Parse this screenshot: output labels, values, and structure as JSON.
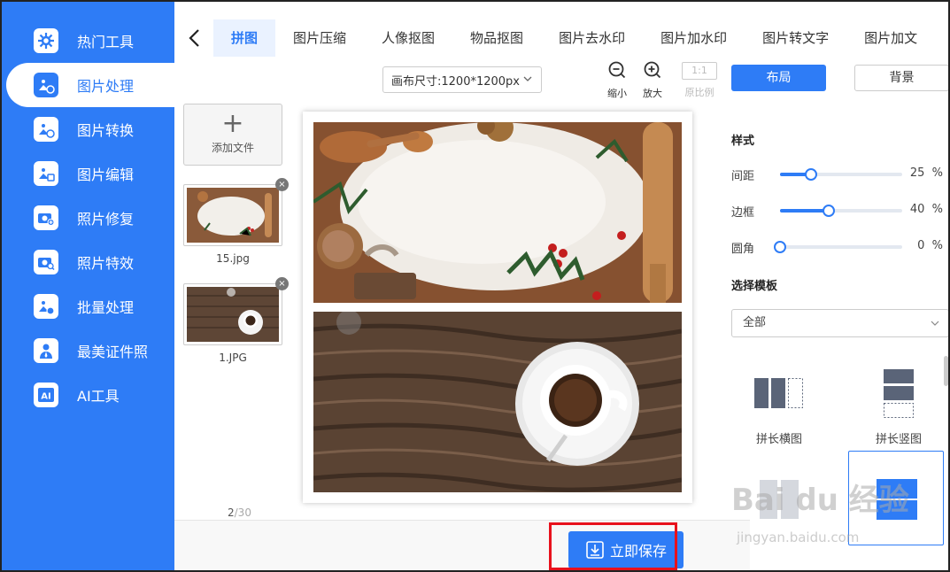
{
  "sidebar": {
    "items": [
      {
        "label": "热门工具",
        "icon": "gear-icon"
      },
      {
        "label": "图片处理",
        "icon": "image-clock-icon",
        "active": true
      },
      {
        "label": "图片转换",
        "icon": "image-convert-icon"
      },
      {
        "label": "图片编辑",
        "icon": "image-edit-icon"
      },
      {
        "label": "照片修复",
        "icon": "camera-plus-icon"
      },
      {
        "label": "照片特效",
        "icon": "camera-search-icon"
      },
      {
        "label": "批量处理",
        "icon": "image-batch-icon"
      },
      {
        "label": "最美证件照",
        "icon": "person-icon"
      },
      {
        "label": "AI工具",
        "icon": "ai-icon"
      }
    ]
  },
  "tabs": {
    "items": [
      "拼图",
      "图片压缩",
      "人像抠图",
      "物品抠图",
      "图片去水印",
      "图片加水印",
      "图片转文字",
      "图片加文"
    ],
    "active": 0
  },
  "toolbar": {
    "canvas_size": "画布尺寸:1200*1200px",
    "zoom_out": "缩小",
    "zoom_in": "放大",
    "ratio_badge": "1:1",
    "original_ratio": "原比例"
  },
  "files": {
    "add_label": "添加文件",
    "plus": "+",
    "close": "×",
    "items": [
      {
        "name": "15.jpg"
      },
      {
        "name": "1.JPG"
      }
    ],
    "count_current": "2",
    "count_total": "/30"
  },
  "panel": {
    "layout_btn": "布局",
    "background_btn": "背景",
    "style_title": "样式",
    "sliders": [
      {
        "label": "间距",
        "value": 25,
        "unit": "%"
      },
      {
        "label": "边框",
        "value": 40,
        "unit": "%"
      },
      {
        "label": "圆角",
        "value": 0,
        "unit": "%"
      }
    ],
    "template_title": "选择模板",
    "template_filter": "全部",
    "templates": [
      {
        "label": "拼长横图"
      },
      {
        "label": "拼长竖图"
      }
    ]
  },
  "save_label": "立即保存",
  "watermark": {
    "main": "Bai du 经验",
    "sub": "jingyan.baidu.com"
  },
  "colors": {
    "primary": "#2E7CF6",
    "highlight": "#E8111C"
  }
}
